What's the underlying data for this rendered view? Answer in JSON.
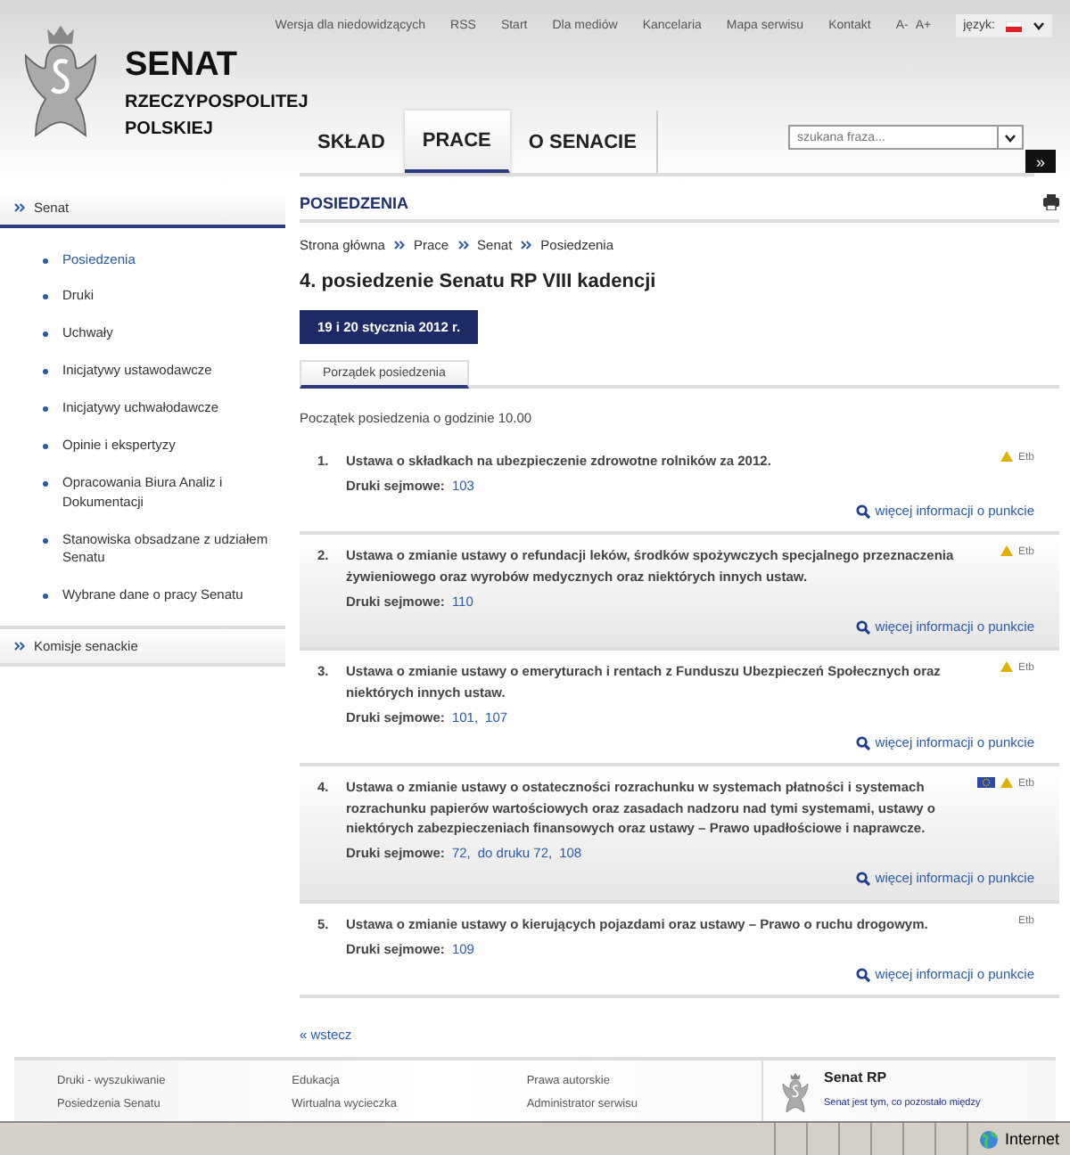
{
  "header": {
    "logo_title": "SENAT",
    "logo_subtitle_1": "RZECZYPOSPOLITEJ",
    "logo_subtitle_2": "POLSKIEJ",
    "top_links": [
      "Wersja dla niedowidzących",
      "RSS",
      "Start",
      "Dla mediów",
      "Kancelaria",
      "Mapa serwisu",
      "Kontakt"
    ],
    "font_small": "A-",
    "font_large": "A+",
    "language_label": "język:",
    "nav_tabs": [
      {
        "label": "SKŁAD",
        "selected": false
      },
      {
        "label": "PRACE",
        "selected": true
      },
      {
        "label": "O SENACIE",
        "selected": false
      }
    ],
    "search": {
      "placeholder": "szukana fraza..."
    },
    "search_go": "»"
  },
  "sidebar": {
    "sections": [
      {
        "label": "Senat",
        "expanded": true,
        "children": [
          {
            "label": "Posiedzenia",
            "selected": true
          },
          {
            "label": "Druki",
            "selected": false
          },
          {
            "label": "Uchwały",
            "selected": false
          },
          {
            "label": "Inicjatywy ustawodawcze",
            "selected": false
          },
          {
            "label": "Inicjatywy uchwałodawcze",
            "selected": false
          },
          {
            "label": "Opinie i ekspertyzy",
            "selected": false
          },
          {
            "label": "Opracowania Biura Analiz i Dokumentacji",
            "selected": false
          },
          {
            "label": "Stanowiska obsadzane z udziałem Senatu",
            "selected": false
          },
          {
            "label": "Wybrane dane o pracy Senatu",
            "selected": false
          }
        ]
      },
      {
        "label": "Komisje senackie",
        "expanded": false
      }
    ]
  },
  "content": {
    "section_title": "POSIEDZENIA",
    "breadcrumb": [
      "Strona główna",
      "Prace",
      "Senat",
      "Posiedzenia"
    ],
    "heading": "4. posiedzenie Senatu RP VIII kadencji",
    "date": "19 i 20 stycznia 2012 r.",
    "tabs": [
      {
        "label": "Porządek posiedzenia",
        "selected": true
      }
    ],
    "intro": "Początek posiedzenia o godzinie 10.00",
    "items": [
      {
        "number": "1.",
        "title": "Ustawa o składkach na ubezpieczenie zdrowotne rolników za 2012.",
        "prints_label": "Druki sejmowe:",
        "prints": [
          "103"
        ],
        "eu": false,
        "warning": true,
        "badge": "Etb",
        "more": "więcej informacji o punkcie",
        "shaded": false
      },
      {
        "number": "2.",
        "title": "Ustawa o zmianie ustawy o refundacji leków, środków spożywczych specjalnego przeznaczenia żywieniowego oraz wyrobów medycznych oraz niektórych innych ustaw.",
        "prints_label": "Druki sejmowe:",
        "prints": [
          "110"
        ],
        "eu": false,
        "warning": true,
        "badge": "Etb",
        "more": "więcej informacji o punkcie",
        "shaded": true
      },
      {
        "number": "3.",
        "title": "Ustawa o zmianie ustawy o emeryturach i rentach z Funduszu Ubezpieczeń Społecznych oraz niektórych innych ustaw.",
        "prints_label": "Druki sejmowe:",
        "prints": [
          "101,",
          "107"
        ],
        "eu": false,
        "warning": true,
        "badge": "Etb",
        "more": "więcej informacji o punkcie",
        "shaded": false
      },
      {
        "number": "4.",
        "title": "Ustawa o zmianie ustawy o ostateczności rozrachunku w systemach płatności i systemach rozrachunku papierów wartościowych oraz zasadach nadzoru nad tymi systemami, ustawy o niektórych zabezpieczeniach finansowych oraz ustawy – Prawo upadłościowe i naprawcze.",
        "prints_label": "Druki sejmowe:",
        "prints": [
          "72,",
          "do druku 72,",
          "108"
        ],
        "eu": true,
        "warning": true,
        "badge": "Etb",
        "more": "więcej informacji o punkcie",
        "shaded": true
      },
      {
        "number": "5.",
        "title": "Ustawa o zmianie ustawy o kierujących pojazdami oraz ustawy – Prawo o ruchu drogowym.",
        "prints_label": "Druki sejmowe:",
        "prints": [
          "109"
        ],
        "eu": false,
        "warning": false,
        "badge": "Etb",
        "more": "więcej informacji o punkcie",
        "shaded": false
      }
    ],
    "back": "« wstecz"
  },
  "footer": {
    "columns": [
      [
        "Druki - wyszukiwanie",
        "Posiedzenia Senatu"
      ],
      [
        "Edukacja",
        "Wirtualna wycieczka"
      ],
      [
        "Prawa autorskie",
        "Administrator serwisu"
      ]
    ],
    "box_title": "Senat RP",
    "box_text": "Senat jest tym, co pozostało między"
  },
  "status_bar": {
    "zone": "Internet"
  }
}
